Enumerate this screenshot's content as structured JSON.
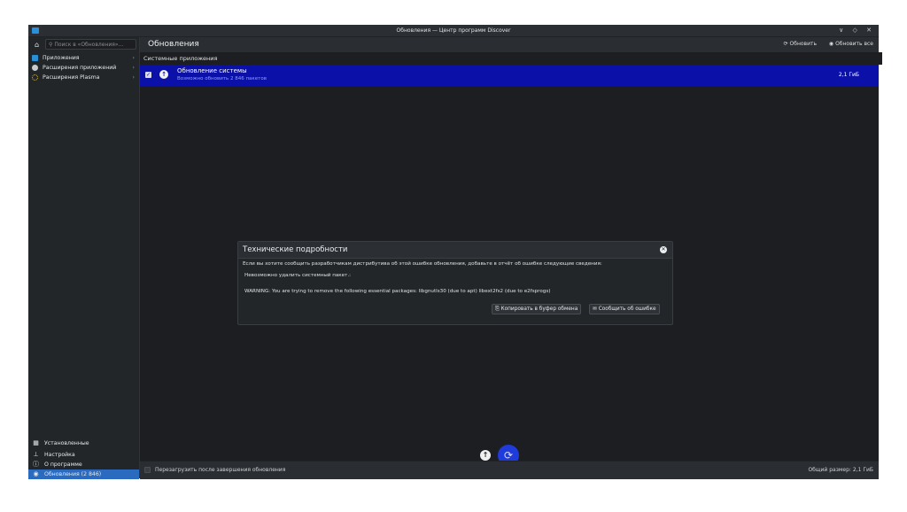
{
  "window": {
    "title": "Обновления — Центр программ Discover",
    "controls": "∨ ◇ ✕"
  },
  "sidebar": {
    "search_placeholder": "Поиск в «Обновления»...",
    "categories": [
      {
        "label": "Приложения",
        "icon": "apps-icon",
        "color": "#2a8fd9"
      },
      {
        "label": "Расширения приложений",
        "icon": "app-addons-icon",
        "color": "#c9cccf"
      },
      {
        "label": "Расширения Plasma",
        "icon": "plasma-addons-icon",
        "color": "#e3c24a"
      }
    ],
    "bottom": [
      {
        "label": "Установленные",
        "icon": "installed-icon"
      },
      {
        "label": "Настройка",
        "icon": "settings-icon"
      },
      {
        "label": "О программе",
        "icon": "about-icon"
      },
      {
        "label": "Обновления (2 846)",
        "icon": "updates-icon",
        "active": true
      }
    ]
  },
  "header": {
    "title": "Обновления",
    "refresh_label": "Обновить",
    "update_all_label": "Обновить все"
  },
  "list": {
    "section": "Системные приложения",
    "items": [
      {
        "title": "Обновление системы",
        "subtitle": "Возможно обновить 2 846 пакетов",
        "size": "2,1 ГиБ",
        "checked": true
      }
    ]
  },
  "footer": {
    "reboot_label": "Перезагрузить после завершения обновления",
    "total_size": "Общий размер: 2,1 ГиБ"
  },
  "dialog": {
    "title": "Технические подробности",
    "intro": "Если вы хотите сообщить разработчикам дистрибутива об этой ошибке обновления, добавьте в отчёт об ошибке следующие сведения:",
    "line1": "Невозможно удалить системный пакет.:",
    "line2": "WARNING: You are trying to remove the following essential packages: libgnutls30 (due to apt) libext2fs2 (due to e2fsprogs)",
    "copy_label": "Копировать в буфер обмена",
    "report_label": "Сообщить об ошибке"
  },
  "colors": {
    "accent": "#2a6bbf",
    "selection": "#0b11a8",
    "fab": "#1f3bdc"
  }
}
